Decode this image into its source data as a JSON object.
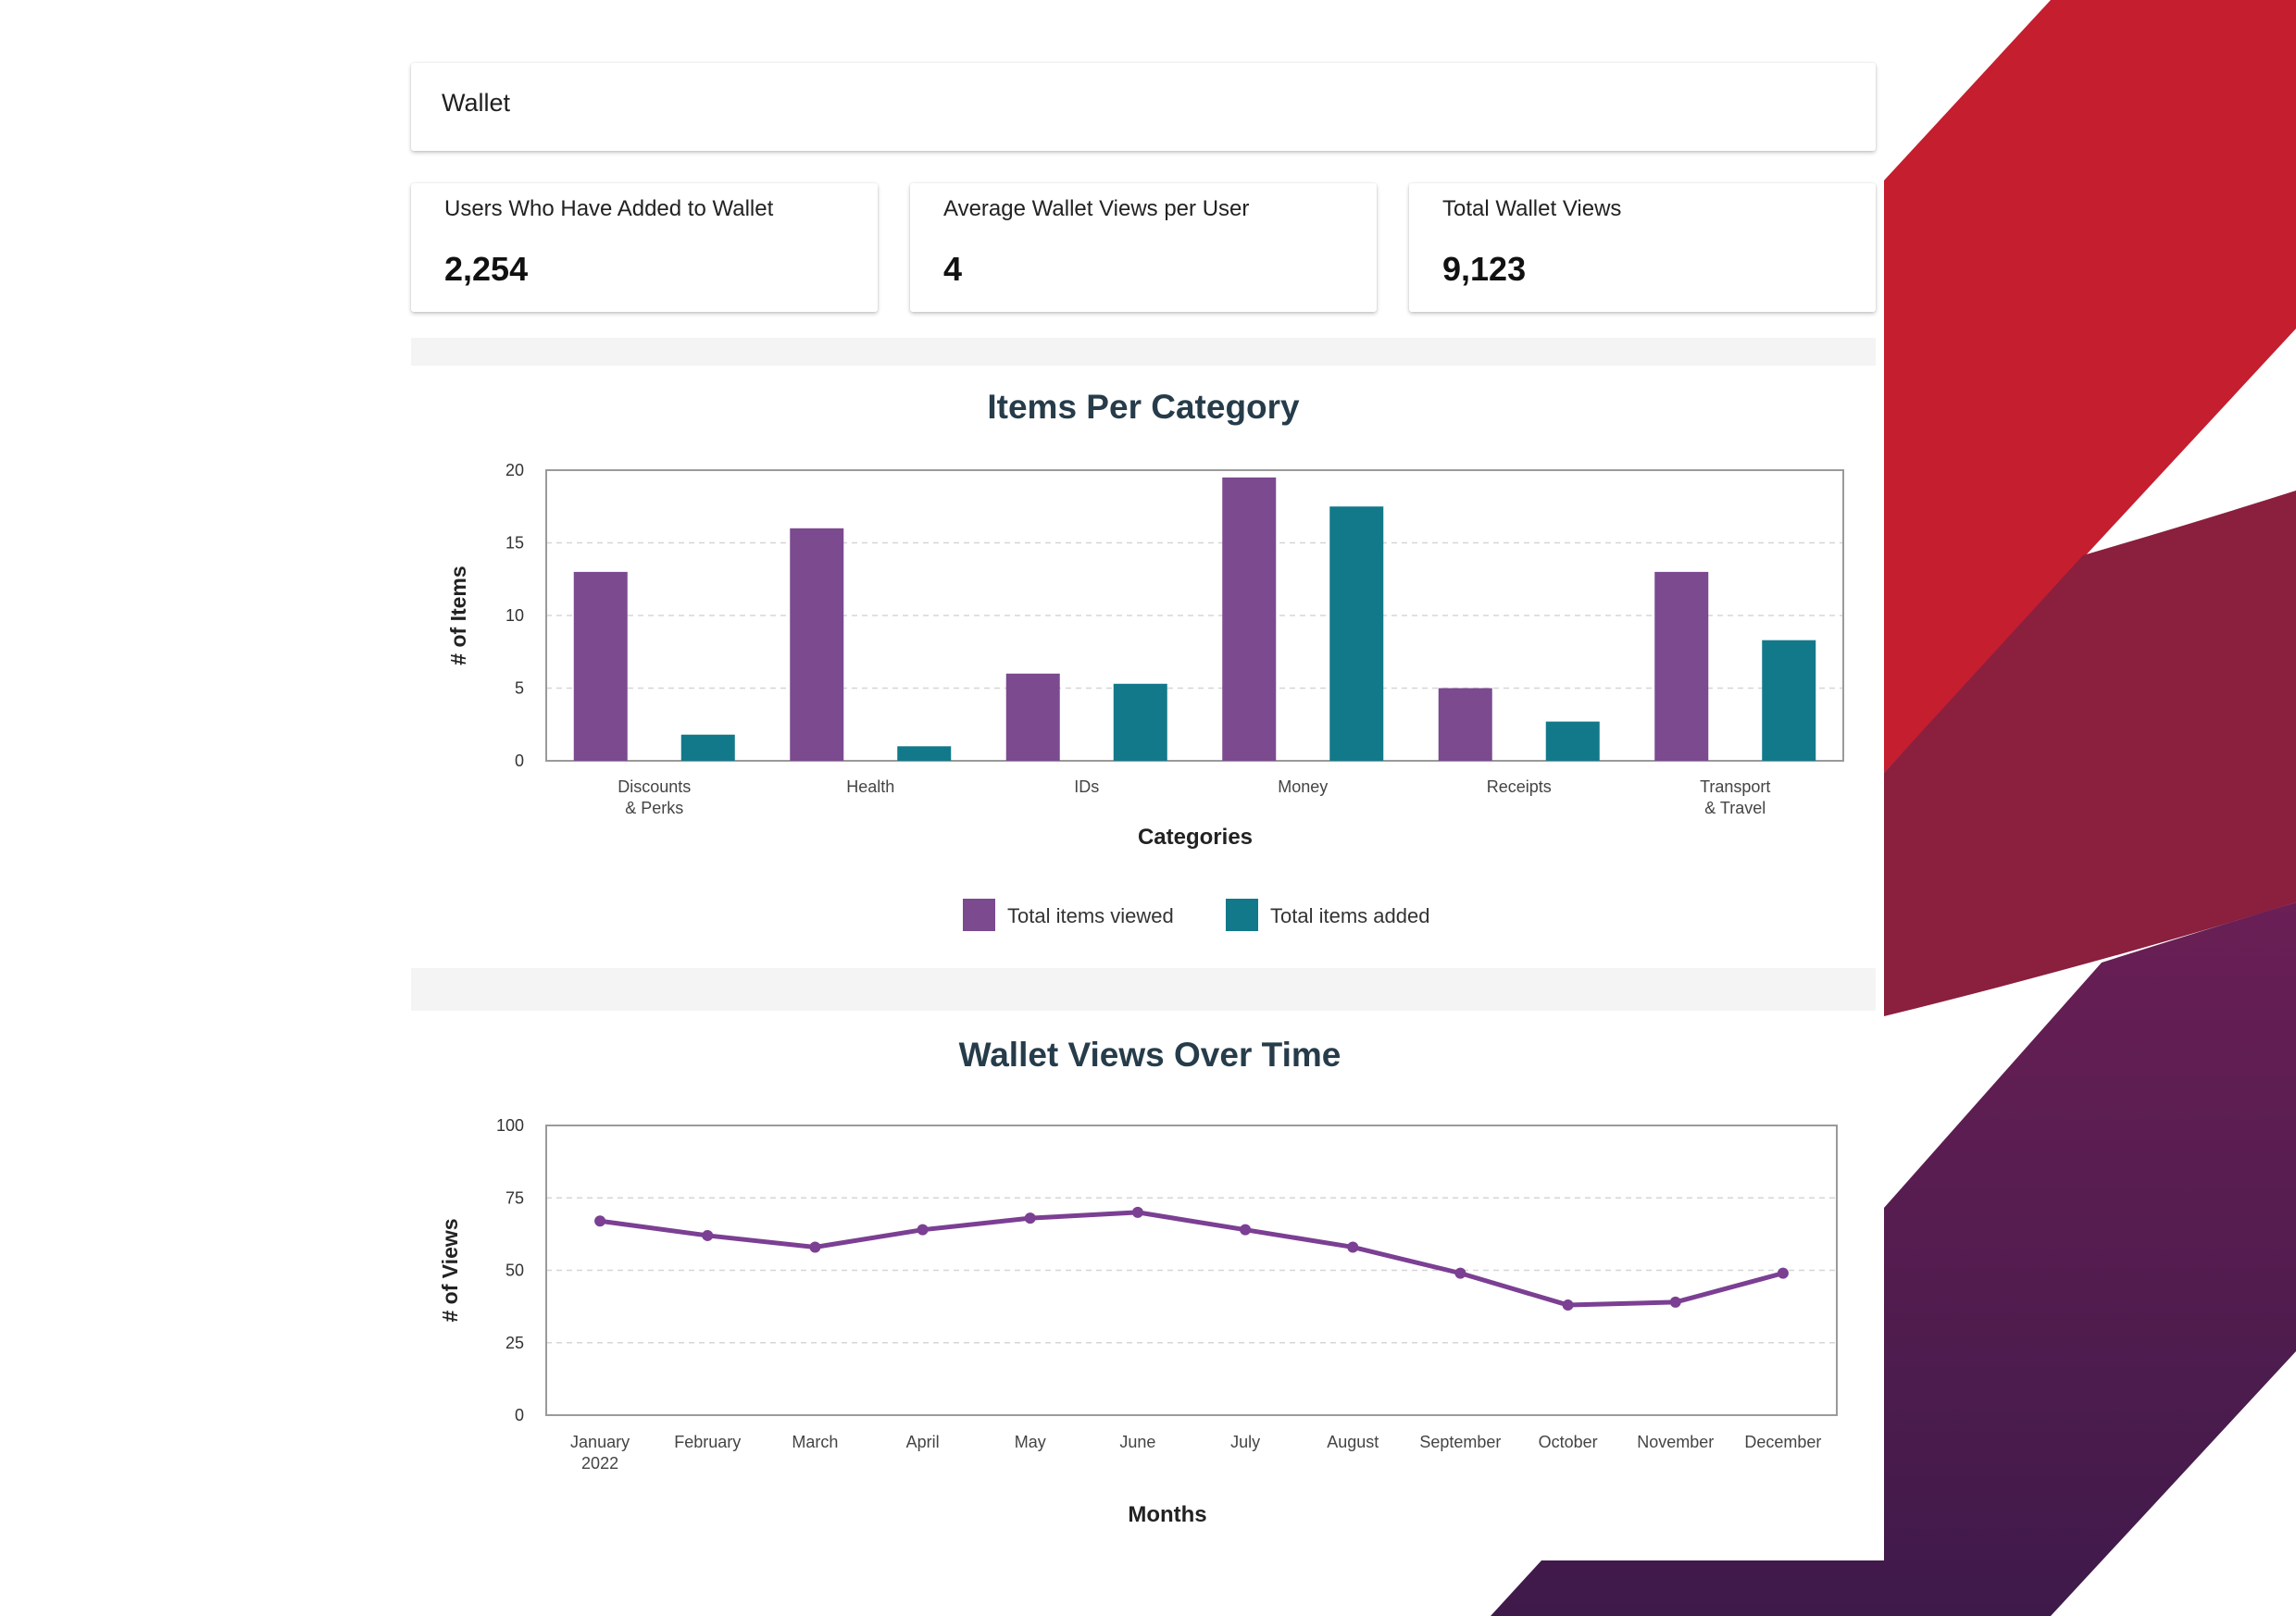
{
  "header": {
    "title": "Wallet"
  },
  "stats": [
    {
      "label": "Users Who Have Added to Wallet",
      "value": "2,254"
    },
    {
      "label": "Average Wallet Views per User",
      "value": "4"
    },
    {
      "label": "Total Wallet Views",
      "value": "9,123"
    }
  ],
  "colors": {
    "viewed": "#7b4a8f",
    "added": "#12798a",
    "line": "#7b3f93",
    "title": "#263c4a",
    "decor_red": "#c41e2f",
    "decor_maroon": "#8a1f3e",
    "decor_purple": "#4c1c4f"
  },
  "chart_data": [
    {
      "type": "bar",
      "title": "Items Per Category",
      "xlabel": "Categories",
      "ylabel": "# of Items",
      "ylim": [
        0,
        20
      ],
      "yticks": [
        0,
        5,
        10,
        15,
        20
      ],
      "grid": true,
      "legend": "bottom",
      "categories": [
        [
          "Discounts",
          "& Perks"
        ],
        [
          "Health"
        ],
        [
          "IDs"
        ],
        [
          "Money"
        ],
        [
          "Receipts"
        ],
        [
          "Transport",
          "& Travel"
        ]
      ],
      "series": [
        {
          "name": "Total items viewed",
          "values": [
            13,
            16,
            6,
            19.5,
            5,
            13
          ]
        },
        {
          "name": "Total items added",
          "values": [
            1.8,
            1,
            5.3,
            17.5,
            2.7,
            8.3
          ]
        }
      ]
    },
    {
      "type": "line",
      "title": "Wallet Views Over Time",
      "xlabel": "Months",
      "ylabel": "# of Views",
      "ylim": [
        0,
        100
      ],
      "yticks": [
        0,
        25,
        50,
        75,
        100
      ],
      "grid": true,
      "x": [
        [
          "January",
          "2022"
        ],
        [
          "February"
        ],
        [
          "March"
        ],
        [
          "April"
        ],
        [
          "May"
        ],
        [
          "June"
        ],
        [
          "July"
        ],
        [
          "August"
        ],
        [
          "September"
        ],
        [
          "October"
        ],
        [
          "November"
        ],
        [
          "December"
        ]
      ],
      "series": [
        {
          "values": [
            67,
            62,
            58,
            64,
            68,
            70,
            64,
            58,
            49,
            38,
            39,
            49
          ]
        }
      ]
    }
  ]
}
